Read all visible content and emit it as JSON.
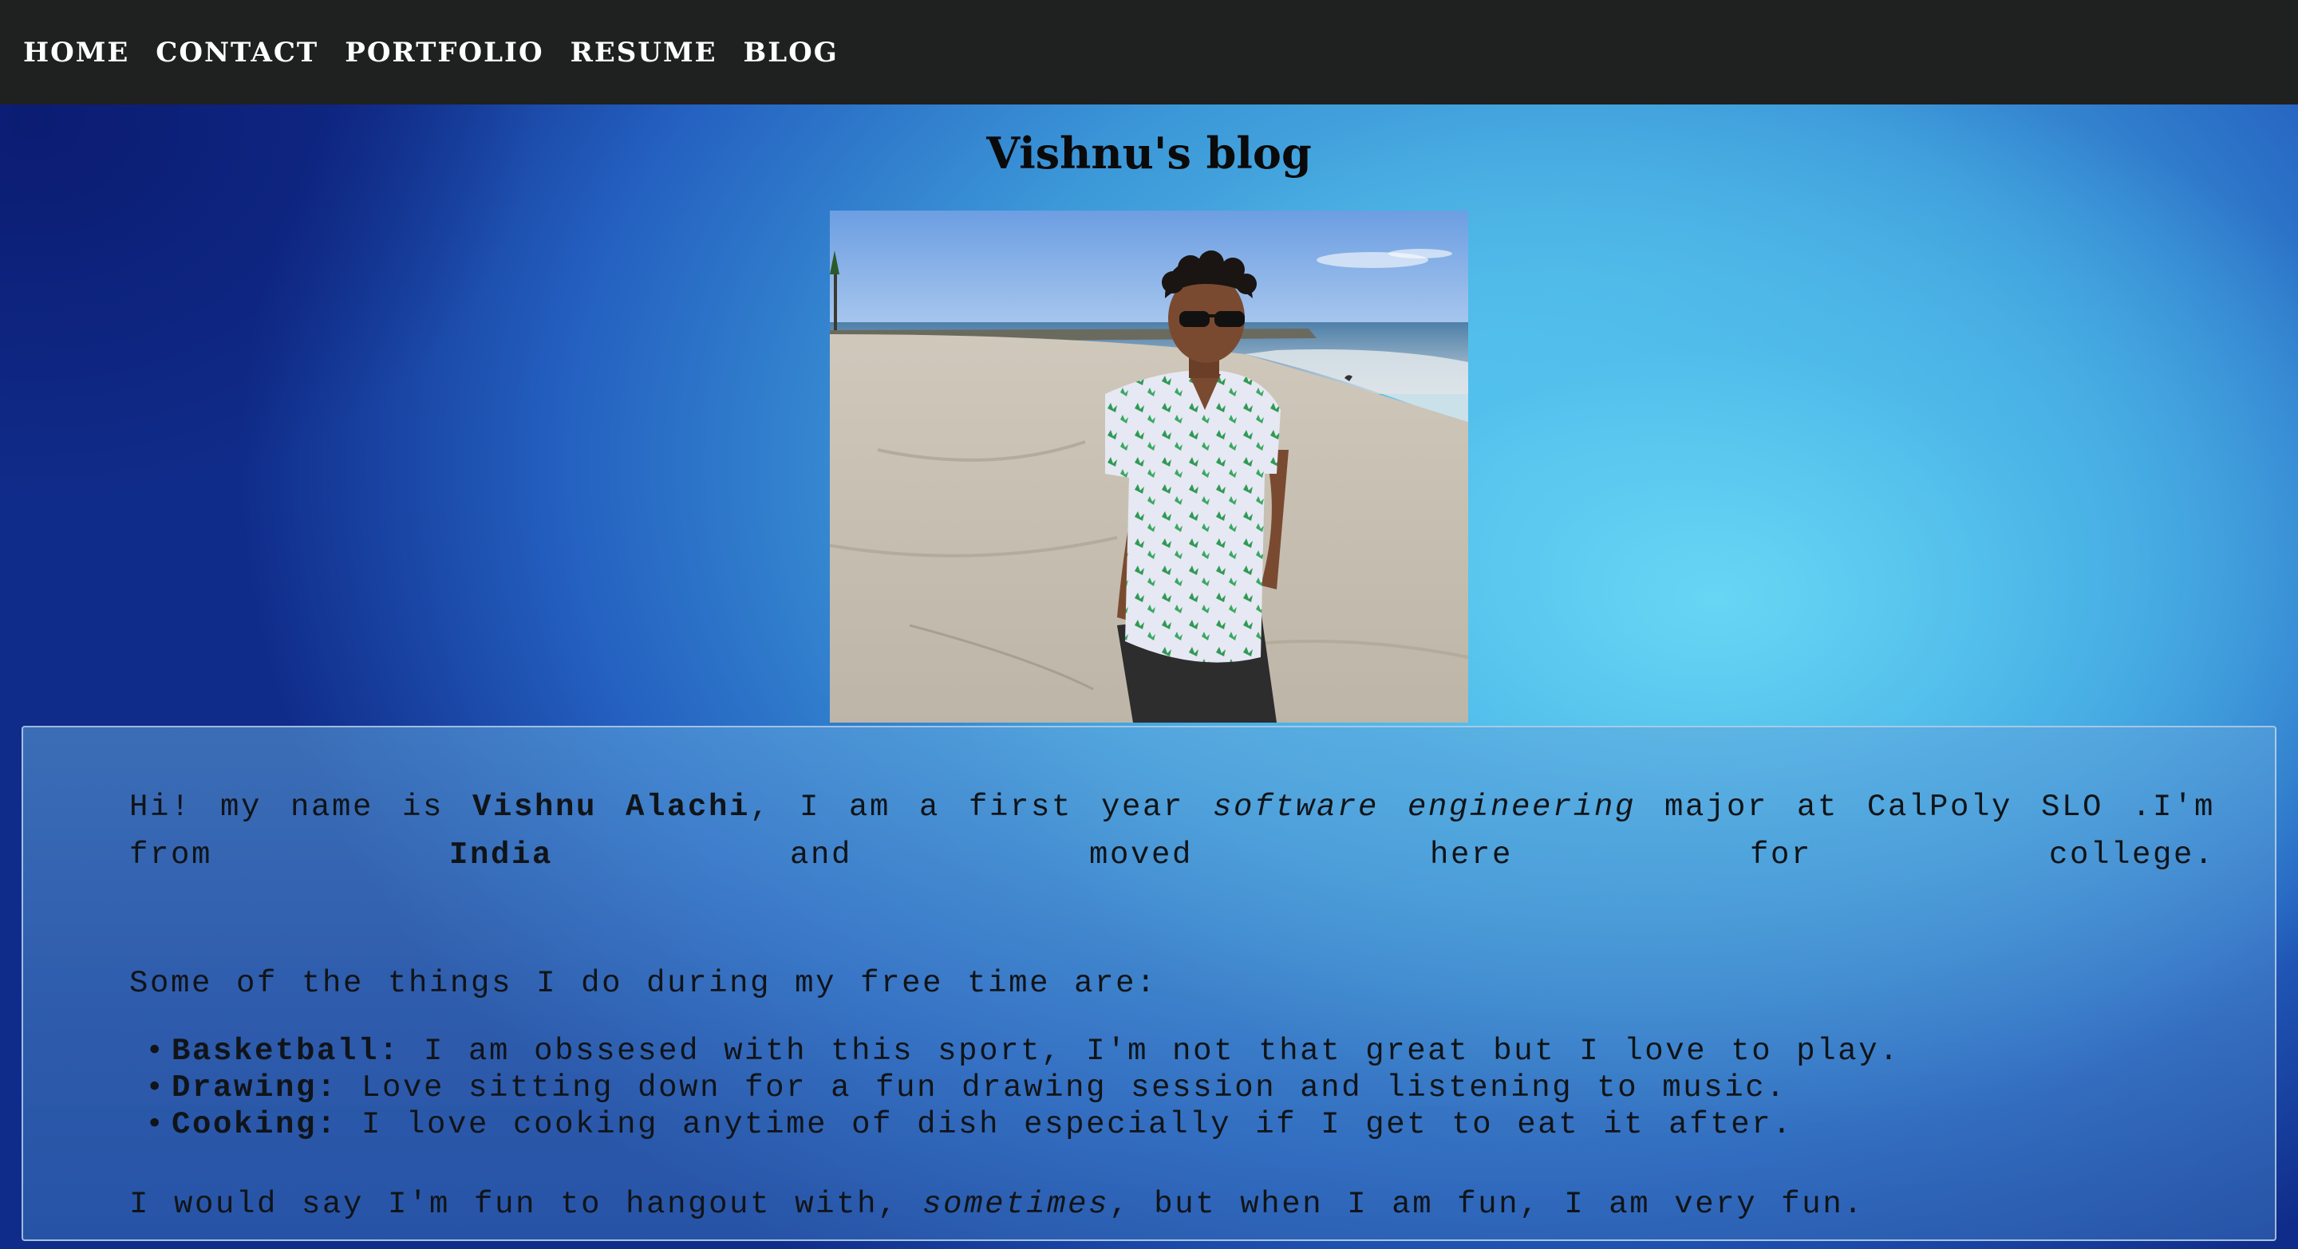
{
  "nav": {
    "items": [
      {
        "label": "HOME"
      },
      {
        "label": "CONTACT"
      },
      {
        "label": "PORTFOLIO"
      },
      {
        "label": "RESUME"
      },
      {
        "label": "BLOG"
      }
    ]
  },
  "colors": {
    "nav_background": "#1f2020",
    "nav_text": "#ffffff",
    "page_background_dark": "#0b1f6a",
    "page_background_light": "#5fcdf0",
    "body_text": "#101418"
  },
  "blog": {
    "title": "Vishnu's blog",
    "photo_alt": "Vishnu standing on a sandy beach wearing a white shirt with green print and sunglasses"
  },
  "about": {
    "intro": {
      "p1": "Hi! my name is ",
      "name": "Vishnu Alachi",
      "p2": ", I am a first year ",
      "major": "software engineering",
      "p3": " major at CalPoly SLO .I'm from ",
      "country": "India",
      "p4": " and moved here for college."
    },
    "free_time_heading": "Some of the things I do during my free time are:",
    "hobbies": [
      {
        "name": "Basketball:",
        "text": " I am obssesed with this sport, I'm not that great but I love to play."
      },
      {
        "name": "Drawing:",
        "text": " Love sitting down for a fun drawing session and listening to music."
      },
      {
        "name": "Cooking:",
        "text": " I love cooking anytime of dish especially if I get to eat it after."
      }
    ],
    "closing": {
      "p1": "I would say I'm fun to hangout with, ",
      "emphasis": "sometimes",
      "p2": ", but when I am fun, I am very fun."
    }
  }
}
